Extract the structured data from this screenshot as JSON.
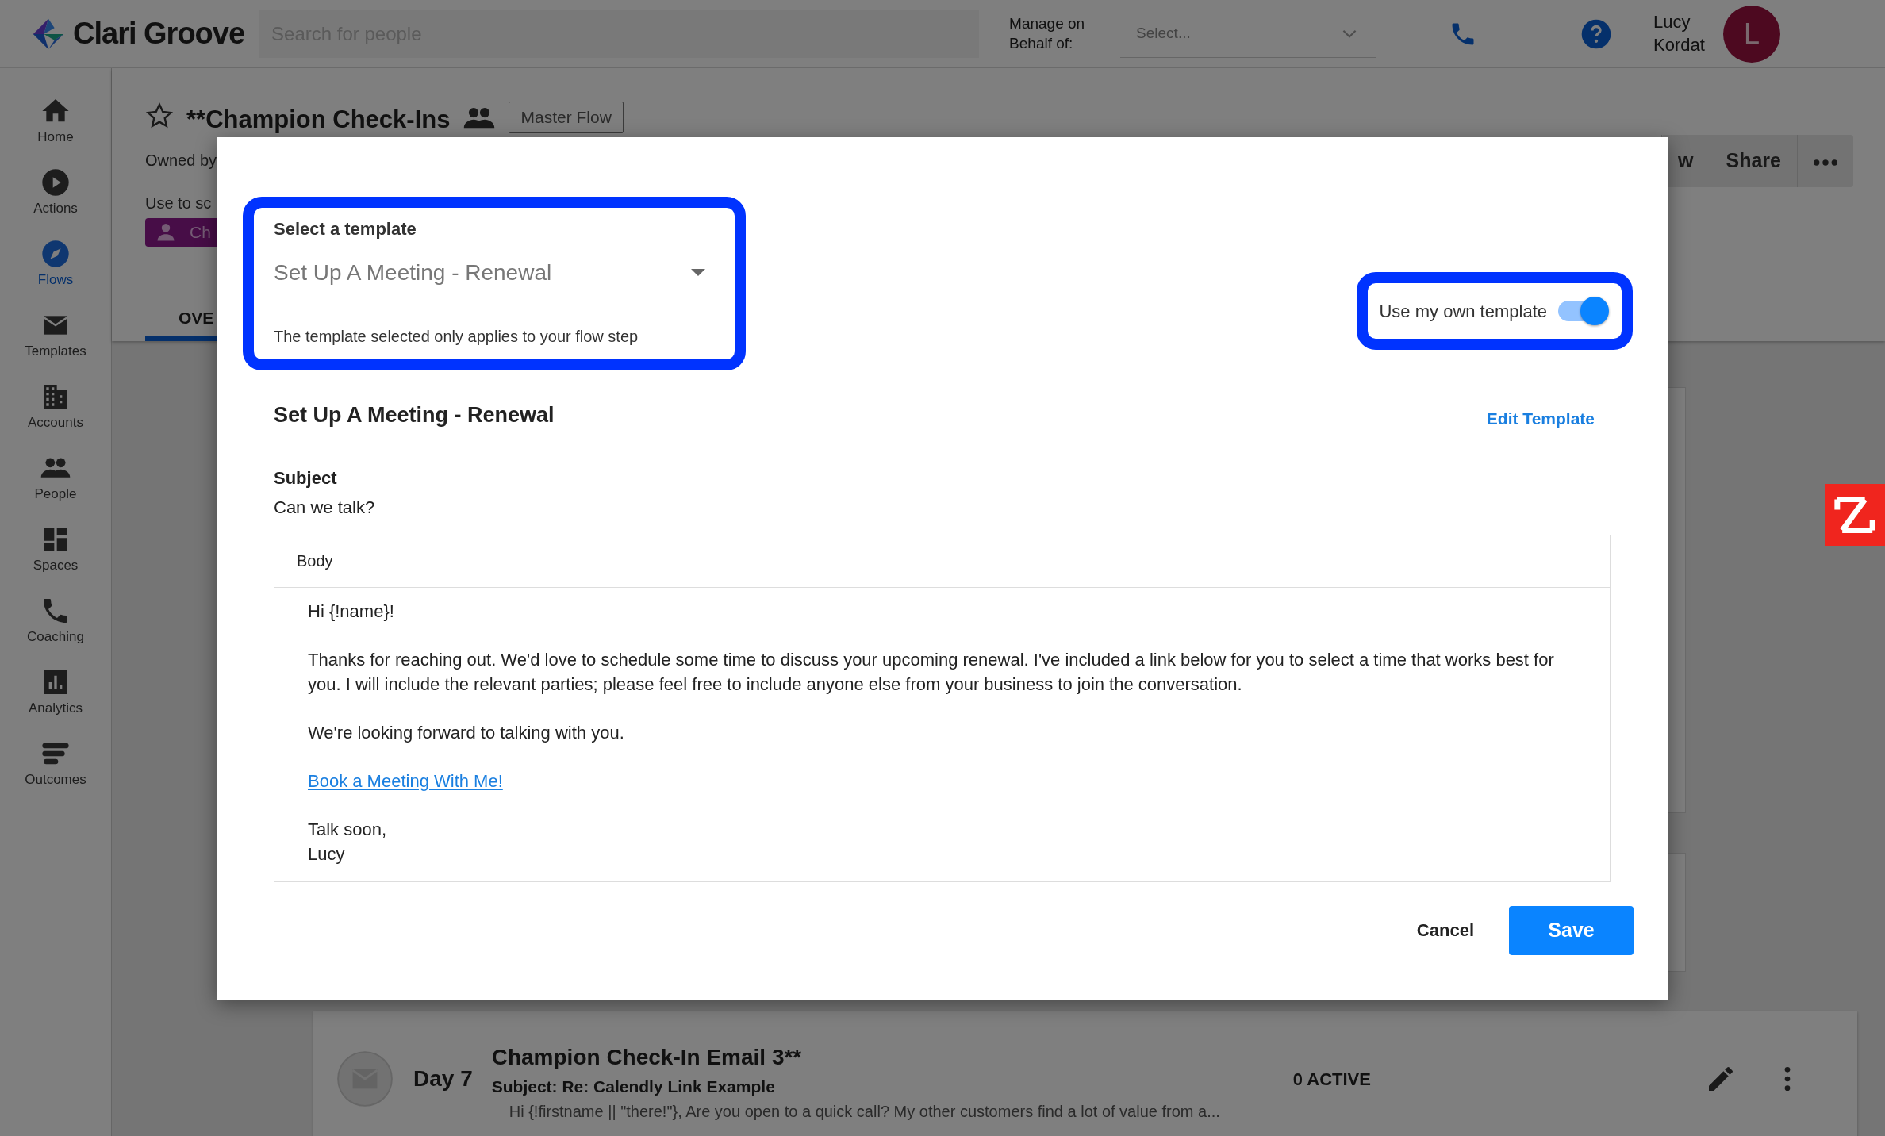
{
  "top_bar": {
    "logo": "Clari Groove",
    "search": {
      "placeholder": "Search for people"
    },
    "manage_label": "Manage on Behalf of:",
    "manage_select": {
      "placeholder": "Select..."
    },
    "user_name": "Lucy Kordat",
    "avatar_initial": "L"
  },
  "sidebar": {
    "items": [
      {
        "label": "Home",
        "selected": false
      },
      {
        "label": "Actions",
        "selected": false
      },
      {
        "label": "Flows",
        "selected": true
      },
      {
        "label": "Templates",
        "selected": false
      },
      {
        "label": "Accounts",
        "selected": false
      },
      {
        "label": "People",
        "selected": false
      },
      {
        "label": "Spaces",
        "selected": false
      },
      {
        "label": "Coaching",
        "selected": false
      },
      {
        "label": "Analytics",
        "selected": false
      },
      {
        "label": "Outcomes",
        "selected": false
      }
    ]
  },
  "flow_header": {
    "title": "**Champion Check-Ins",
    "badge": "Master Flow",
    "owned_by": "Owned by",
    "use_to": "Use to sc",
    "chip": "Ch",
    "tabs": [
      {
        "label": "OVE",
        "selected": true
      }
    ],
    "actions": [
      "w",
      "Share"
    ]
  },
  "steps": [
    {
      "day": "Day 7",
      "title": "Champion Check-In Email 3**",
      "subject": "Subject: Re: Calendly Link Example",
      "preview": "Hi {!firstname || \"there!\"}, Are you open to a quick call? My other customers find a lot of value from a...",
      "status": "0 ACTIVE"
    }
  ],
  "modal": {
    "template_select": {
      "label": "Select a template",
      "value": "Set Up A Meeting - Renewal",
      "helper": "The template selected only applies to your flow step"
    },
    "own_template": {
      "label": "Use my own template",
      "on": true
    },
    "template_name": "Set Up A Meeting - Renewal",
    "edit_link": "Edit Template",
    "subject_label": "Subject",
    "subject": "Can we talk?",
    "body": {
      "label": "Body",
      "paragraphs": [
        {
          "kind": "paragraph",
          "text": "Hi {!name}!"
        },
        {
          "kind": "paragraph",
          "text": "Thanks for reaching out. We'd love to schedule some time to discuss your upcoming renewal. I've included a link below for you to select a time that works best for you. I will include the relevant parties; please feel free to include anyone else from your business to join the conversation."
        },
        {
          "kind": "paragraph",
          "text": "We're looking forward to talking with you."
        },
        {
          "kind": "link",
          "text": "Book a Meeting With Me!"
        },
        {
          "kind": "line",
          "text": "Talk soon,"
        },
        {
          "kind": "line",
          "text": "Lucy"
        }
      ]
    },
    "buttons": {
      "cancel": "Cancel",
      "save": "Save"
    }
  }
}
